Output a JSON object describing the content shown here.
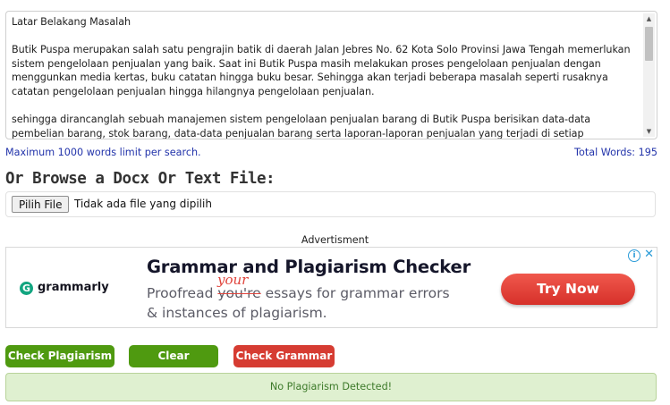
{
  "editor": {
    "paragraphs": [
      "Latar Belakang Masalah",
      "Butik Puspa merupakan salah satu pengrajin batik di daerah Jalan Jebres No. 62 Kota Solo Provinsi Jawa Tengah memerlukan sistem pengelolaan penjualan yang baik. Saat ini Butik Puspa masih melakukan proses pengelolaan penjualan dengan menggunkan media kertas, buku catatan hingga buku besar. Sehingga akan terjadi beberapa masalah seperti rusaknya catatan pengelolaan penjualan hingga hilangnya pengelolaan penjualan.",
      "sehingga dirancanglah sebuah manajemen sistem pengelolaan penjualan barang di Butik Puspa berisikan data-data pembelian barang, stok barang, data-data penjualan barang serta laporan-laporan penjualan yang terjadi di setiap bulannya. Dari sistem ini kita dapat menyelesaikan masalah laporan pengelolaan penjualan barang dengan cepat dan kapan saja kita butuhkan. hasil"
    ]
  },
  "limit_text": "Maximum 1000 words limit per search.",
  "total_words": "Total Words: 195",
  "browse_heading": "Or Browse a Docx Or Text File:",
  "file_input": {
    "button_label": "Pilih File",
    "status": "Tidak ada file yang dipilih"
  },
  "ad": {
    "label": "Advertisment",
    "brand": "grammarly",
    "title": "Grammar and Plagiarism Checker",
    "desc_line1_before": "Proofread ",
    "desc_strike": "you're",
    "desc_line1_after": " essays for grammar errors",
    "desc_correction": "your",
    "desc_line2": "& instances of plagiarism.",
    "cta": "Try Now",
    "info_glyph": "i",
    "close_glyph": "✕"
  },
  "buttons": {
    "check_plagiarism": "Check Plagiarism",
    "clear": "Clear",
    "check_grammar": "Check Grammar"
  },
  "result": "No Plagiarism Detected!",
  "colors": {
    "green_button": "#4f9a10",
    "red_button": "#d63c32",
    "link_blue": "#2233aa",
    "result_bg": "#dff0d0"
  }
}
